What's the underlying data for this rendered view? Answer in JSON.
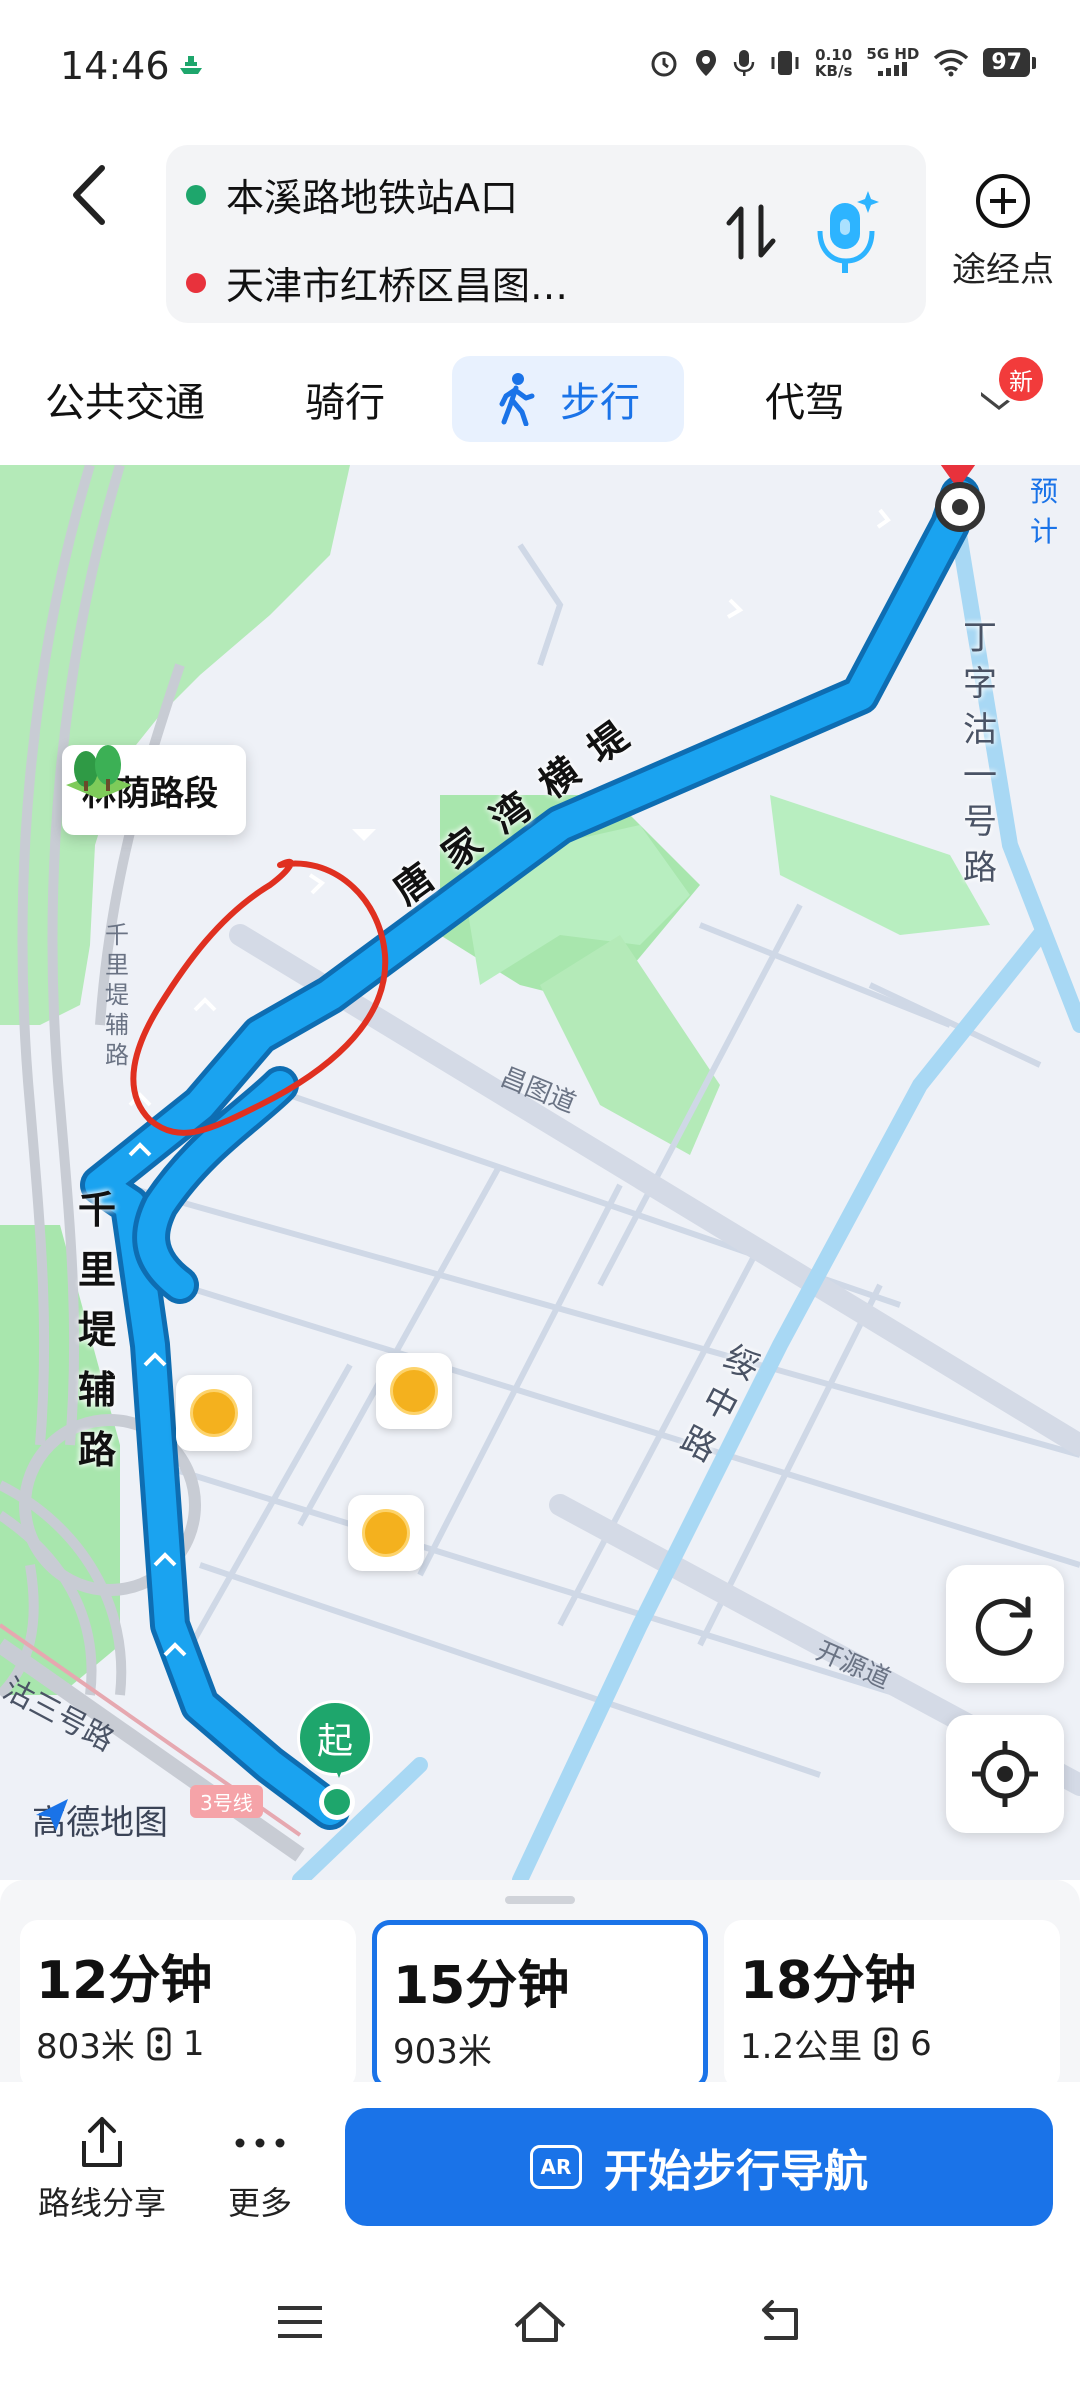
{
  "status_bar": {
    "time": "14:46",
    "net_speed_value": "0.10",
    "net_speed_unit": "KB/s",
    "signal": "5G HD",
    "battery": "97"
  },
  "route": {
    "origin": "本溪路地铁站A口",
    "destination": "天津市红桥区昌图…",
    "waypoint_label": "途经点",
    "origin_color": "#1ea66c",
    "destination_color": "#e8323c"
  },
  "tabs": [
    {
      "label": "公共交通"
    },
    {
      "label": "骑行"
    },
    {
      "label": "步行",
      "active": true
    },
    {
      "label": "代驾"
    }
  ],
  "new_badge": "新",
  "map": {
    "callout": "林荫路段",
    "roads": {
      "tangjiawan": "唐家湾横堤",
      "dingzigu": "丁字沽一号路",
      "qianlidi": "千里堤辅路",
      "qianlidi_small": "千里堤辅路",
      "changtu": "昌图道",
      "suizhong": "绥中路",
      "kaiyuan": "开源道",
      "sanhao": "沽三号路"
    },
    "top_right_label": "预计",
    "metro_badge": "3号线",
    "start_marker": "起",
    "logo": "高德地图",
    "route_color": "#1aa3f0",
    "highlight_color": "#e03020"
  },
  "options": [
    {
      "duration": "12分钟",
      "distance": "803米",
      "lights": "1"
    },
    {
      "duration": "15分钟",
      "distance": "903米",
      "active": true
    },
    {
      "duration": "18分钟",
      "distance": "1.2公里",
      "lights": "6"
    }
  ],
  "actions": {
    "share": "路线分享",
    "more": "更多",
    "start_nav": "开始步行导航",
    "ar": "AR"
  }
}
